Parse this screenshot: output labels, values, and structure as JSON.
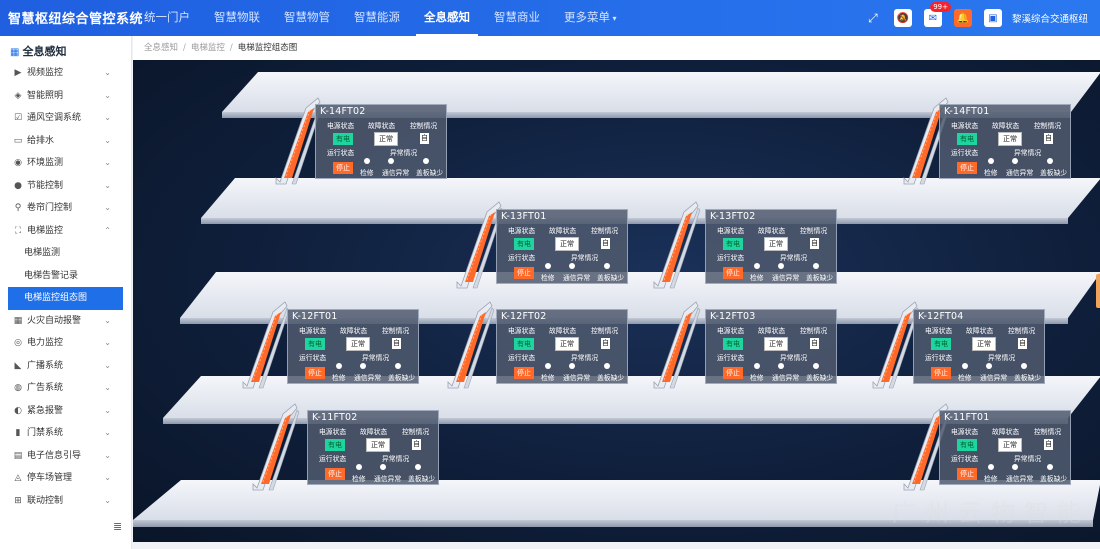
{
  "app_title": "智慧枢纽综合管控系统",
  "nav": [
    {
      "label": "统一门户",
      "active": false
    },
    {
      "label": "智慧物联",
      "active": false
    },
    {
      "label": "智慧物管",
      "active": false
    },
    {
      "label": "智慧能源",
      "active": false
    },
    {
      "label": "全息感知",
      "active": true
    },
    {
      "label": "智慧商业",
      "active": false
    },
    {
      "label": "更多菜单",
      "active": false
    }
  ],
  "header": {
    "mail_badge": "99+",
    "user_name": "黎溪综合交通枢纽"
  },
  "sidebar": {
    "title": "全息感知",
    "items": [
      {
        "label": "视频监控",
        "icon": "video-icon"
      },
      {
        "label": "智能照明",
        "icon": "light-icon"
      },
      {
        "label": "通风空调系统",
        "icon": "hvac-icon"
      },
      {
        "label": "给排水",
        "icon": "water-icon"
      },
      {
        "label": "环境监测",
        "icon": "eye-icon"
      },
      {
        "label": "节能控制",
        "icon": "globe-icon"
      },
      {
        "label": "卷帘门控制",
        "icon": "person-icon"
      },
      {
        "label": "电梯监控",
        "icon": "elevator-icon",
        "expanded": true
      }
    ],
    "subitems": [
      {
        "label": "电梯监测",
        "active": false
      },
      {
        "label": "电梯告警记录",
        "active": false
      },
      {
        "label": "电梯监控组态图",
        "active": true
      }
    ],
    "items_after": [
      {
        "label": "火灾自动报警",
        "icon": "fire-alarm-icon"
      },
      {
        "label": "电力监控",
        "icon": "power-icon"
      },
      {
        "label": "广播系统",
        "icon": "broadcast-icon"
      },
      {
        "label": "广告系统",
        "icon": "ad-icon"
      },
      {
        "label": "紧急报警",
        "icon": "alarm-icon"
      },
      {
        "label": "门禁系统",
        "icon": "access-icon"
      },
      {
        "label": "电子信息引导",
        "icon": "screen-icon"
      },
      {
        "label": "停车场管理",
        "icon": "parking-icon"
      },
      {
        "label": "联动控制",
        "icon": "link-icon"
      }
    ]
  },
  "breadcrumb": [
    "全息感知",
    "电梯监控",
    "电梯监控组态图"
  ],
  "panel_labels": {
    "power": "电源状态",
    "fault": "故障状态",
    "exception": "控制情况",
    "run": "运行状态",
    "abnormal": "异常情况",
    "power_val": "有电",
    "fault_val": "正常",
    "exception_val": "自",
    "run_val": "停止",
    "dot1": "检修",
    "dot2": "通信异常",
    "dot3": "盖板缺少"
  },
  "escalators": [
    {
      "id": "K-14FT02"
    },
    {
      "id": "K-14FT01"
    },
    {
      "id": "K-13FT01"
    },
    {
      "id": "K-13FT02"
    },
    {
      "id": "K-12FT01"
    },
    {
      "id": "K-12FT02"
    },
    {
      "id": "K-12FT03"
    },
    {
      "id": "K-12FT04"
    },
    {
      "id": "K-11FT02"
    },
    {
      "id": "K-11FT01"
    }
  ],
  "watermark": "广州云物智能",
  "colors": {
    "accent": "#1f6fe8",
    "power_ok": "#1ed5a0",
    "stopped": "#ff6a2b",
    "escalator": "#ff6a2b"
  }
}
